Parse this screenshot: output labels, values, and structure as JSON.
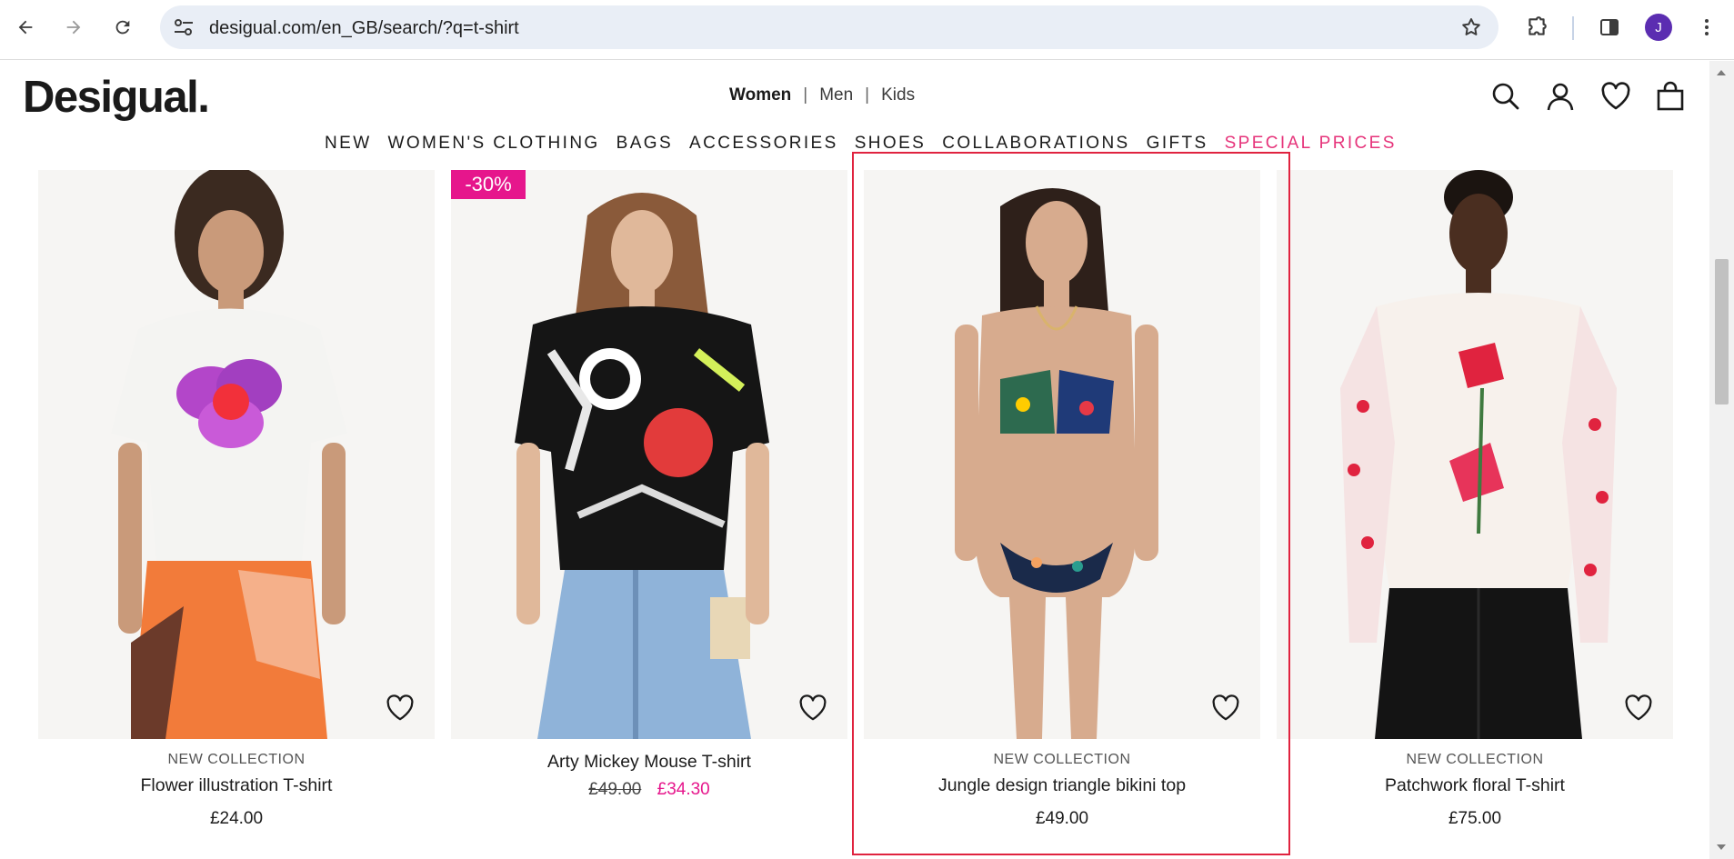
{
  "browser": {
    "url": "desigual.com/en_GB/search/?q=t-shirt",
    "avatar_letter": "J",
    "icons": [
      "back-arrow-icon",
      "forward-arrow-icon",
      "reload-icon",
      "site-info-icon",
      "bookmark-star-icon",
      "extensions-icon",
      "side-panel-icon",
      "menu-dots-icon"
    ]
  },
  "site": {
    "logo": "Desigual.",
    "gender_tabs": [
      {
        "label": "Women",
        "active": true
      },
      {
        "label": "Men",
        "active": false
      },
      {
        "label": "Kids",
        "active": false
      }
    ],
    "gender_sep": "|",
    "nav": [
      "NEW",
      "WOMEN'S CLOTHING",
      "BAGS",
      "ACCESSORIES",
      "SHOES",
      "COLLABORATIONS",
      "GIFTS",
      "SPECIAL PRICES"
    ],
    "header_icons": [
      "search-icon",
      "account-icon",
      "wishlist-icon",
      "bag-icon"
    ],
    "accent_color": "#e6168c"
  },
  "products": [
    {
      "tag": "NEW COLLECTION",
      "name": "Flower illustration T-shirt",
      "price": "£24.00"
    },
    {
      "badge": "-30%",
      "name": "Arty Mickey Mouse T-shirt",
      "old_price": "£49.00",
      "sale_price": "£34.30"
    },
    {
      "tag": "NEW COLLECTION",
      "name": "Jungle design triangle bikini top",
      "price": "£49.00"
    },
    {
      "tag": "NEW COLLECTION",
      "name": "Patchwork floral T-shirt",
      "price": "£75.00"
    }
  ]
}
